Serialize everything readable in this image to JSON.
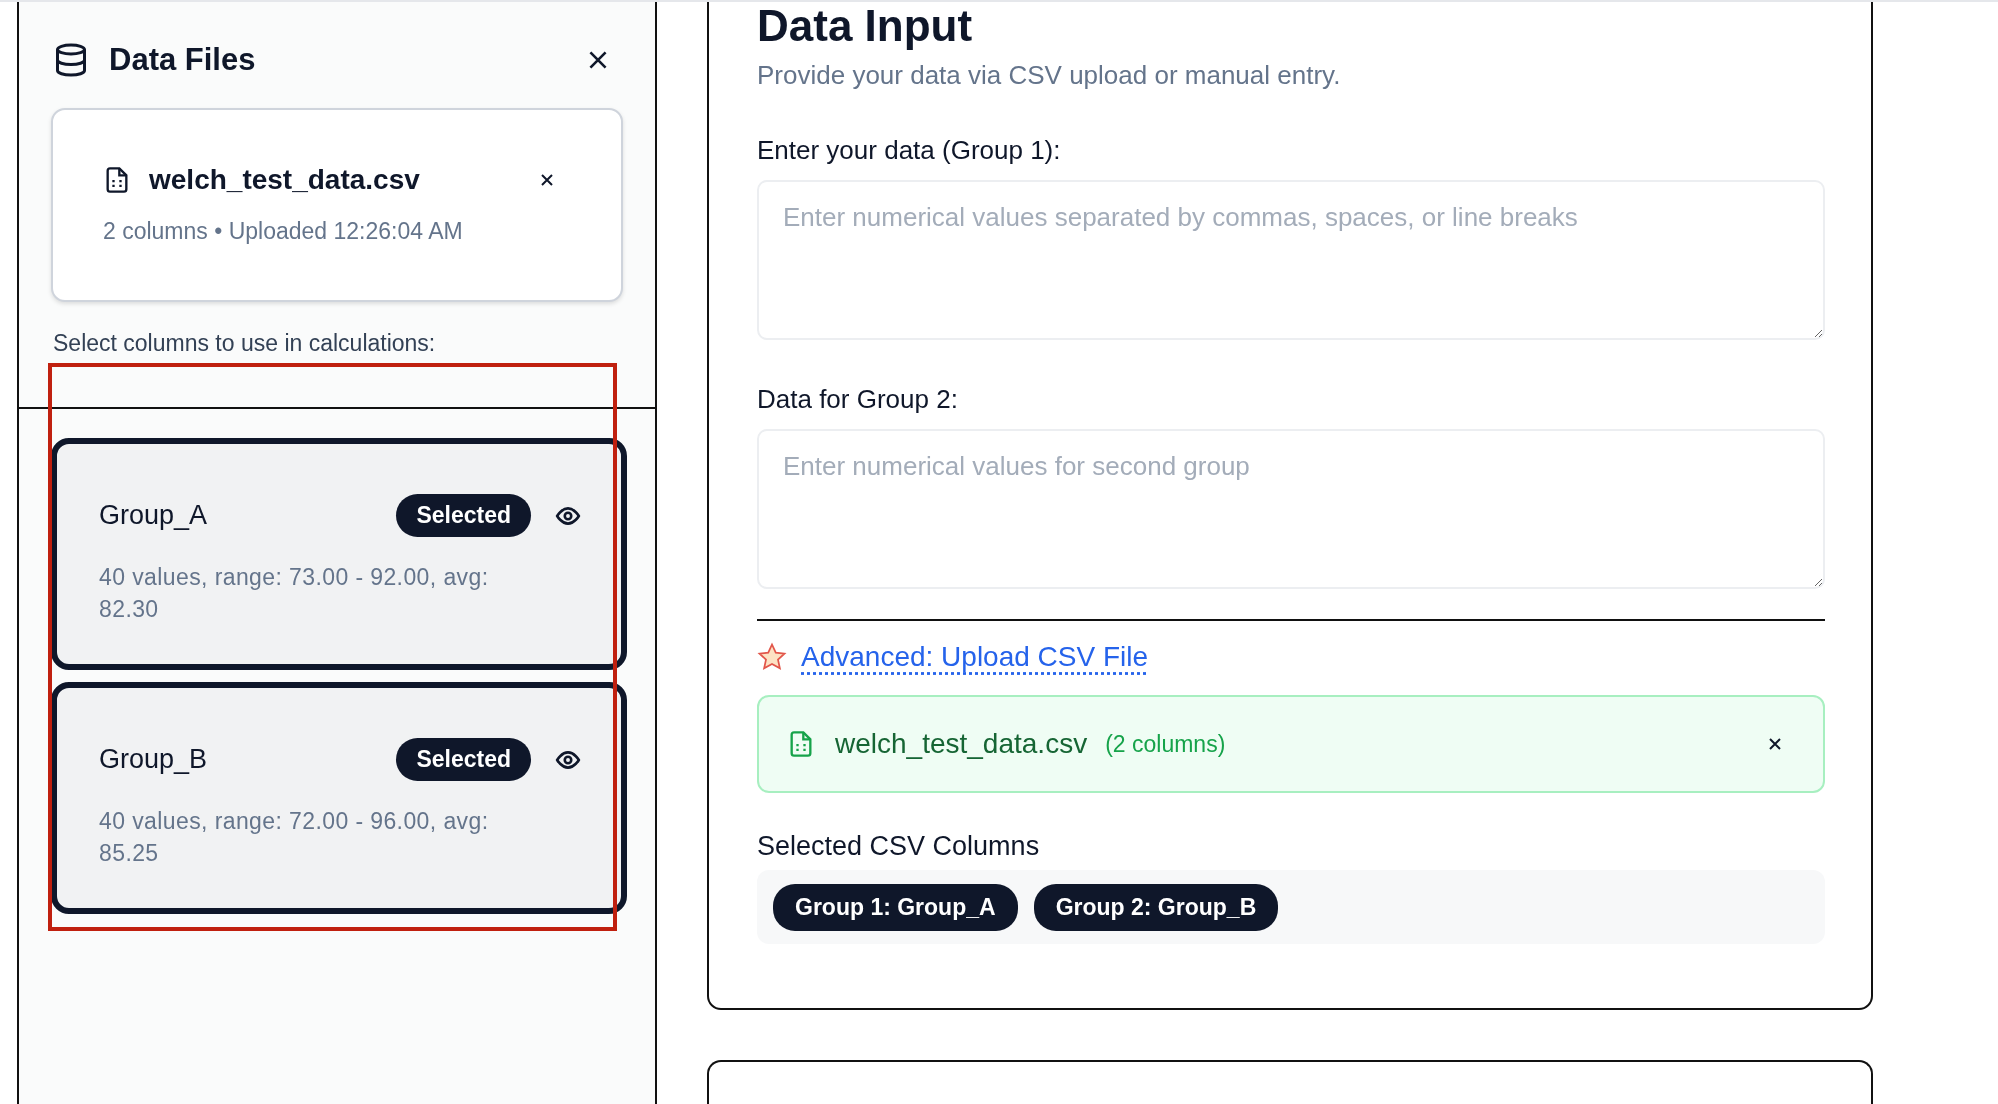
{
  "sidebar": {
    "title": "Data Files",
    "file": {
      "name": "welch_test_data.csv",
      "meta": "2 columns • Uploaded 12:26:04 AM"
    },
    "prompt": "Select columns to use in calculations:",
    "columns": [
      {
        "name": "Group_A",
        "selected": true,
        "badge": "Selected",
        "stats": "40 values, range: 73.00 - 92.00, avg: 82.30"
      },
      {
        "name": "Group_B",
        "selected": true,
        "badge": "Selected",
        "stats": "40 values, range: 72.00 - 96.00, avg: 85.25"
      }
    ]
  },
  "main": {
    "title": "Data Input",
    "subtitle": "Provide your data via CSV upload or manual entry.",
    "fields": [
      {
        "label": "Enter your data (Group 1):",
        "placeholder": "Enter numerical values separated by commas, spaces, or line breaks"
      },
      {
        "label": "Data for Group 2:",
        "placeholder": "Enter numerical values for second group"
      }
    ],
    "link": "Advanced: Upload CSV File",
    "upload": {
      "name": "welch_test_data.csv",
      "count": "(2 columns)"
    },
    "selected_heading": "Selected CSV Columns",
    "chips": [
      "Group 1: Group_A",
      "Group 2: Group_B"
    ]
  }
}
